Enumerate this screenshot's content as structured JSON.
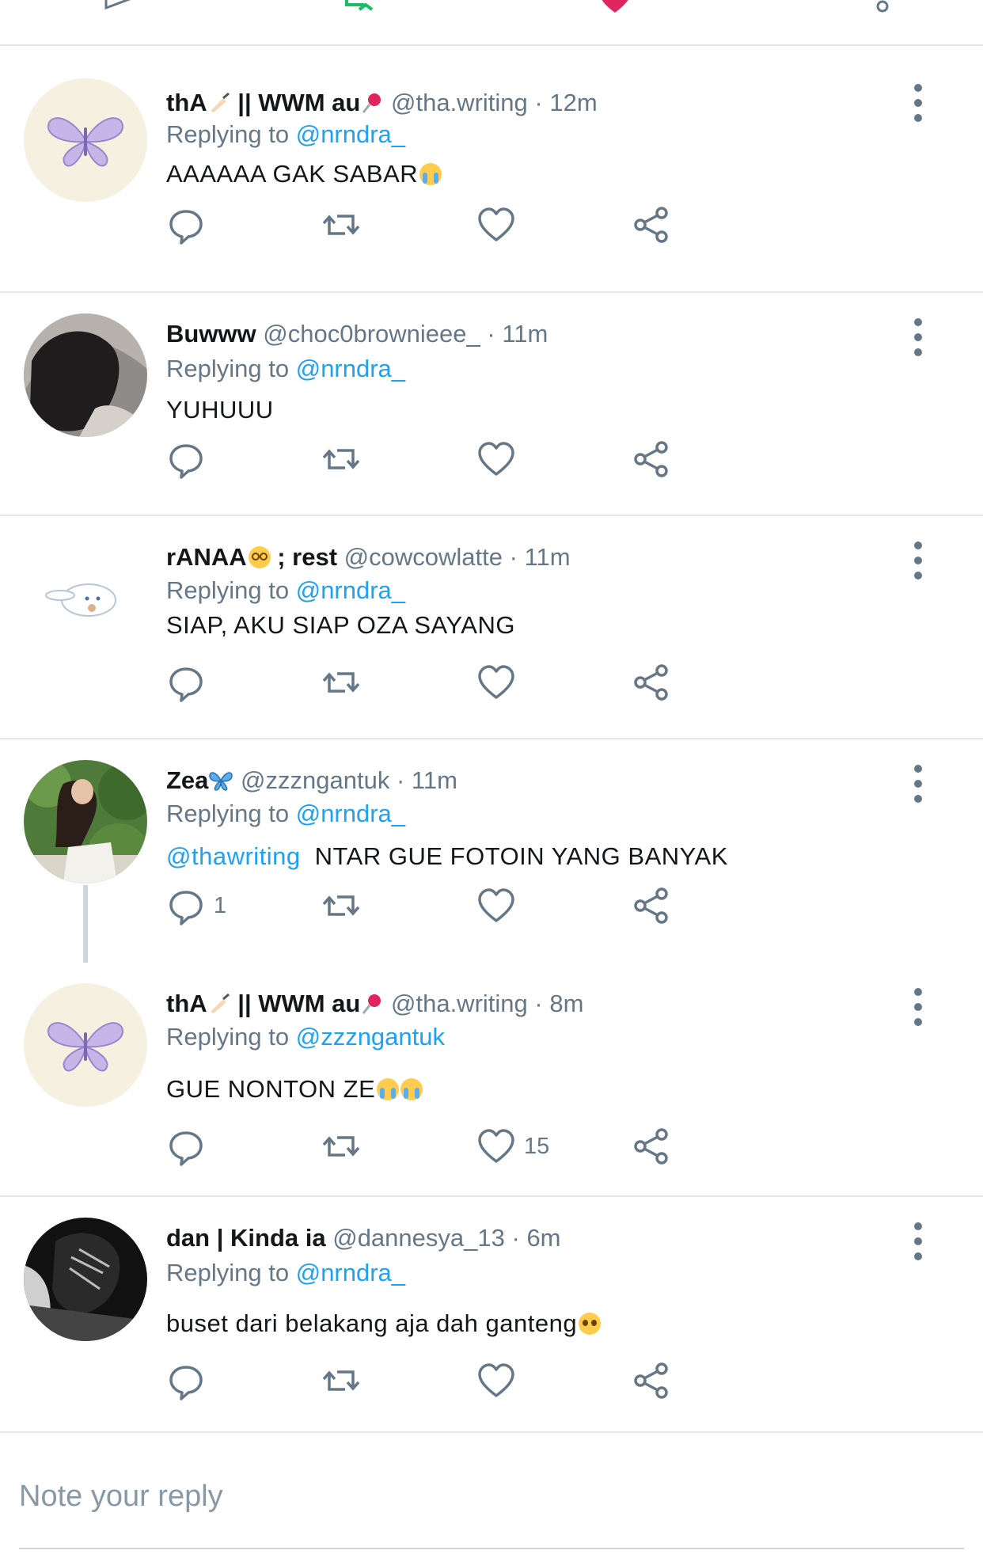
{
  "colors": {
    "link": "#1da1f2",
    "secondary_text": "#657786",
    "divider": "#e1e8ed",
    "retweet_green": "#17bf63",
    "like_red": "#e0245e"
  },
  "icons": {
    "reply": "speech-bubble-icon",
    "retweet": "retweet-arrows-icon",
    "like": "heart-icon",
    "share": "share-nodes-icon",
    "more": "vertical-dots-icon"
  },
  "tweets": [
    {
      "name": "thA",
      "name_suffix": " || WWM au",
      "handle": "@tha.writing",
      "separator": "·",
      "time": "12m",
      "replying_prefix": "Replying to",
      "replying_to": "@nrndra_",
      "body": "AAAAAA GAK SABAR",
      "avatar": "butterfly-avatar"
    },
    {
      "name": "Buwww",
      "handle": "@choc0brownieee_",
      "separator": "·",
      "time": "11m",
      "replying_prefix": "Replying to",
      "replying_to": "@nrndra_",
      "body": "YUHUUU",
      "avatar": "photo-avatar-dark"
    },
    {
      "name": "rANAA",
      "name_suffix": " ; rest",
      "handle": "@cowcowlatte",
      "separator": "·",
      "time": "11m",
      "replying_prefix": "Replying to",
      "replying_to": "@nrndra_",
      "body": "SIAP, AKU SIAP OZA SAYANG",
      "avatar": "cinnamoroll-avatar"
    },
    {
      "name": "Zea",
      "handle": "@zzzngantuk",
      "separator": "·",
      "time": "11m",
      "replying_prefix": "Replying to",
      "replying_to": "@nrndra_",
      "body_mention": "@thawriting",
      "body": "NTAR GUE FOTOIN YANG BANYAK",
      "reply_count": "1",
      "avatar": "photo-avatar-trees"
    },
    {
      "name": "thA",
      "name_suffix": " || WWM au",
      "handle": "@tha.writing",
      "separator": "·",
      "time": "8m",
      "replying_prefix": "Replying to",
      "replying_to": "@zzzngantuk",
      "body": "GUE NONTON ZE",
      "like_count": "15",
      "avatar": "butterfly-avatar"
    },
    {
      "name": "dan | Kinda ia",
      "handle": "@dannesya_13",
      "separator": "·",
      "time": "6m",
      "replying_prefix": "Replying to",
      "replying_to": "@nrndra_",
      "body": "buset dari belakang aja dah ganteng",
      "avatar": "photo-avatar-bw"
    }
  ],
  "reply_bar": {
    "placeholder": "Note your reply"
  }
}
